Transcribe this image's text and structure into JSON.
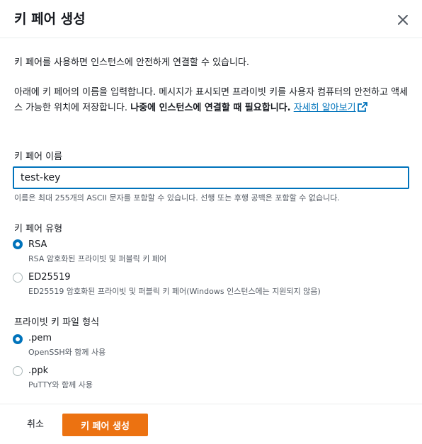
{
  "modal": {
    "title": "키 페어 생성",
    "intro": "키 페어를 사용하면 인스턴스에 안전하게 연결할 수 있습니다.",
    "description": "아래에 키 페어의 이름을 입력합니다. 메시지가 표시되면 프라이빗 키를 사용자 컴퓨터의 안전하고 액세스 가능한 위치에 저장합니다. ",
    "description_bold": "나중에 인스턴스에 연결할 때 필요합니다.",
    "learn_more": "자세히 알아보기"
  },
  "name_field": {
    "label": "키 페어 이름",
    "value": "test-key",
    "hint": "이름은 최대 255개의 ASCII 문자를 포함할 수 있습니다. 선행 또는 후행 공백은 포함할 수 없습니다."
  },
  "key_type": {
    "label": "키 페어 유형",
    "options": [
      {
        "label": "RSA",
        "desc": "RSA 암호화된 프라이빗 및 퍼블릭 키 페어",
        "selected": true
      },
      {
        "label": "ED25519",
        "desc": "ED25519 암호화된 프라이빗 및 퍼블릭 키 페어(Windows 인스턴스에는 지원되지 않음)",
        "selected": false
      }
    ]
  },
  "file_format": {
    "label": "프라이빗 키 파일 형식",
    "options": [
      {
        "label": ".pem",
        "desc": "OpenSSH와 함께 사용",
        "selected": true
      },
      {
        "label": ".ppk",
        "desc": "PuTTY와 함께 사용",
        "selected": false
      }
    ]
  },
  "footer": {
    "cancel_label": "취소",
    "create_label": "키 페어 생성"
  },
  "colors": {
    "accent": "#0073bb",
    "primary_button": "#ec7211"
  }
}
